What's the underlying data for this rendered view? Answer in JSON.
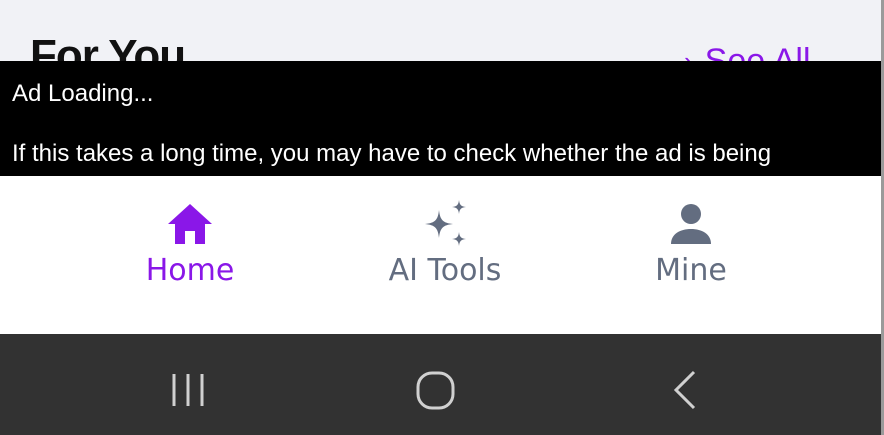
{
  "section": {
    "title": "For You",
    "see_all": "See All",
    "see_all_icon": "chevron-right-icon"
  },
  "ad": {
    "title": "Ad Loading...",
    "message": "If this takes a long time, you may have to check whether the ad is being"
  },
  "bottom_nav": {
    "items": [
      {
        "label": "Home",
        "icon": "home-icon",
        "active": true
      },
      {
        "label": "AI Tools",
        "icon": "sparkles-icon",
        "active": false
      },
      {
        "label": "Mine",
        "icon": "person-icon",
        "active": false
      }
    ]
  },
  "system_nav": {
    "buttons": [
      "recents-icon",
      "home-circle-icon",
      "back-icon"
    ]
  },
  "colors": {
    "accent": "#8a17e8",
    "inactive": "#636d80",
    "ad_background": "#000000",
    "system_bar": "#323232",
    "page_background": "#f1f2f6"
  }
}
